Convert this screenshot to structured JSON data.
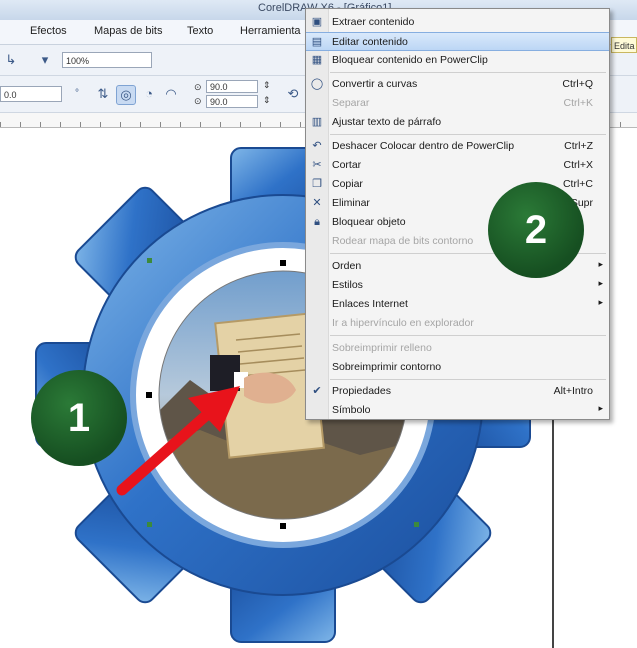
{
  "app": {
    "title": "CorelDRAW X6 - [Gráfico1]",
    "menus": [
      "Efectos",
      "Mapas de bits",
      "Texto",
      "Herramienta"
    ],
    "zoom": "100%",
    "x_value": "0.0",
    "angle_1": "90.0",
    "angle_2": "90.0",
    "right_edge_label": "Edita"
  },
  "context_menu": {
    "items": [
      {
        "label": "Extraer contenido",
        "shortcut": "",
        "icon": "extract-icon",
        "state": "normal"
      },
      {
        "label": "Editar contenido",
        "shortcut": "",
        "icon": "edit-contents-icon",
        "state": "highlighted"
      },
      {
        "label": "Bloquear contenido en PowerClip",
        "shortcut": "",
        "icon": "lock-contents-icon",
        "state": "normal"
      },
      {
        "label": "Convertir a curvas",
        "shortcut": "Ctrl+Q",
        "icon": "convert-curves-icon",
        "state": "normal"
      },
      {
        "label": "Separar",
        "shortcut": "Ctrl+K",
        "icon": "",
        "state": "disabled"
      },
      {
        "label": "Ajustar texto de párrafo",
        "shortcut": "",
        "icon": "wrap-text-icon",
        "state": "normal"
      },
      {
        "label": "Deshacer Colocar dentro de PowerClip",
        "shortcut": "Ctrl+Z",
        "icon": "undo-icon",
        "state": "normal"
      },
      {
        "label": "Cortar",
        "shortcut": "Ctrl+X",
        "icon": "cut-icon",
        "state": "normal"
      },
      {
        "label": "Copiar",
        "shortcut": "Ctrl+C",
        "icon": "copy-icon",
        "state": "normal"
      },
      {
        "label": "Eliminar",
        "shortcut": "Supr",
        "icon": "delete-icon",
        "state": "normal"
      },
      {
        "label": "Bloquear objeto",
        "shortcut": "",
        "icon": "lock-object-icon",
        "state": "normal"
      },
      {
        "label": "Rodear mapa de bits contorno",
        "shortcut": "",
        "icon": "",
        "state": "disabled"
      },
      {
        "label": "Orden",
        "shortcut": "",
        "icon": "",
        "state": "submenu"
      },
      {
        "label": "Estilos",
        "shortcut": "",
        "icon": "",
        "state": "submenu"
      },
      {
        "label": "Enlaces Internet",
        "shortcut": "",
        "icon": "",
        "state": "submenu"
      },
      {
        "label": "Ir a hipervínculo en explorador",
        "shortcut": "",
        "icon": "",
        "state": "disabled"
      },
      {
        "label": "Sobreimprimir relleno",
        "shortcut": "",
        "icon": "",
        "state": "disabled"
      },
      {
        "label": "Sobreimprimir contorno",
        "shortcut": "",
        "icon": "",
        "state": "normal"
      },
      {
        "label": "Propiedades",
        "shortcut": "Alt+Intro",
        "icon": "check-icon",
        "state": "normal"
      },
      {
        "label": "Símbolo",
        "shortcut": "",
        "icon": "",
        "state": "submenu"
      }
    ]
  },
  "badges": {
    "step1": "1",
    "step2": "2"
  },
  "colors": {
    "badge": "#1b5e27",
    "arrow": "#e8131b",
    "gear": "#2a6bc4",
    "highlight": "#bcd6f5"
  }
}
